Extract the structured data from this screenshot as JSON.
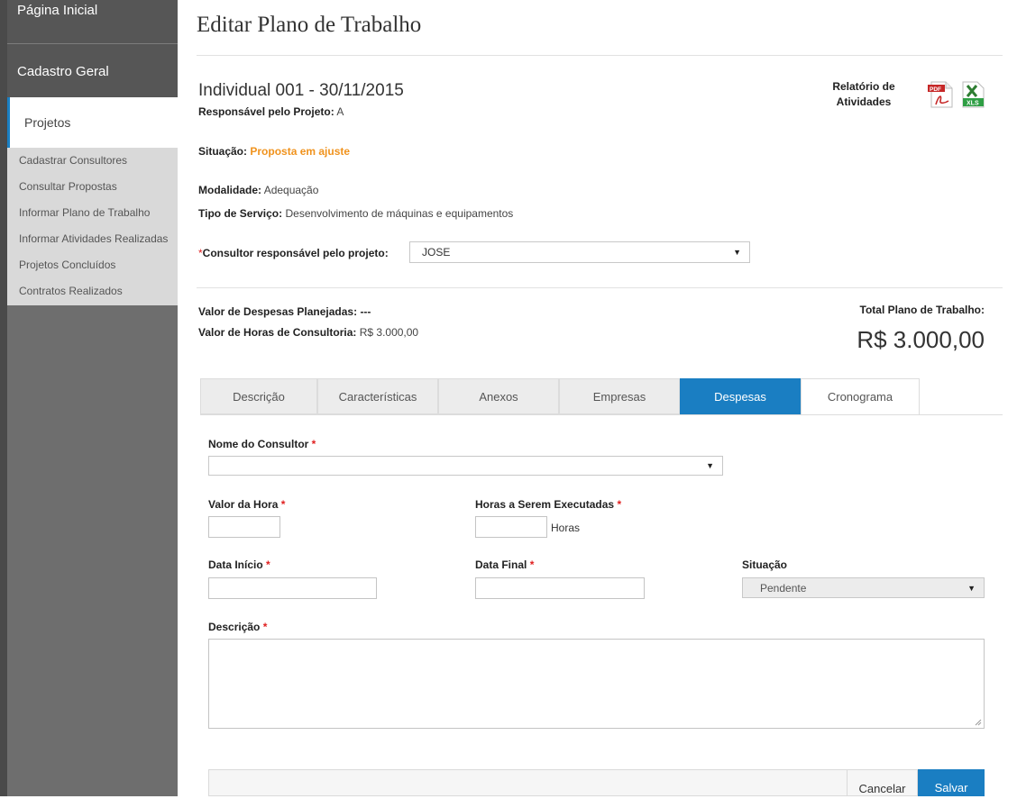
{
  "sidebar": {
    "home": "Página Inicial",
    "cadastro": "Cadastro Geral",
    "projetos": "Projetos",
    "items": [
      "Cadastrar Consultores",
      "Consultar Propostas",
      "Informar Plano de Trabalho",
      "Informar Atividades Realizadas",
      "Projetos Concluídos",
      "Contratos Realizados"
    ]
  },
  "page": {
    "title": "Editar Plano de Trabalho"
  },
  "project": {
    "title": "Individual 001 - 30/11/2015",
    "responsavel_label": "Responsável pelo Projeto:",
    "responsavel_value": "A",
    "situacao_label": "Situação:",
    "situacao_value": "Proposta em ajuste",
    "modalidade_label": "Modalidade:",
    "modalidade_value": "Adequação",
    "tipo_label": "Tipo de Serviço:",
    "tipo_value": "Desenvolvimento de máquinas e equipamentos",
    "consultor_label": "Consultor responsável pelo projeto:",
    "consultor_value": "JOSE",
    "required_mark": "*"
  },
  "report": {
    "label_line1": "Relatório de",
    "label_line2": "Atividades",
    "pdf_text": "PDF",
    "xls_text": "XLS"
  },
  "summary": {
    "despesas_label": "Valor de Despesas Planejadas:",
    "despesas_value": "---",
    "horas_label": "Valor de Horas de Consultoria:",
    "horas_value": "R$ 3.000,00",
    "total_label": "Total Plano de Trabalho:",
    "total_value": "R$ 3.000,00"
  },
  "tabs": [
    {
      "label": "Descrição"
    },
    {
      "label": "Características"
    },
    {
      "label": "Anexos"
    },
    {
      "label": "Empresas"
    },
    {
      "label": "Despesas"
    },
    {
      "label": "Cronograma"
    }
  ],
  "form": {
    "nome_consultor": "Nome do Consultor",
    "valor_hora": "Valor da Hora",
    "horas_executadas": "Horas a Serem Executadas",
    "horas_unit": "Horas",
    "data_inicio": "Data Início",
    "data_final": "Data Final",
    "situacao": "Situação",
    "situacao_value": "Pendente",
    "descricao": "Descrição",
    "req": "*"
  },
  "buttons": {
    "cancel": "Cancelar",
    "save": "Salvar"
  },
  "colors": {
    "accent": "#1a7ec2",
    "status": "#f0931e",
    "required": "#e02020"
  },
  "icons": [
    "pdf-icon",
    "xls-icon",
    "chevron-down-icon",
    "resize-handle-icon"
  ]
}
